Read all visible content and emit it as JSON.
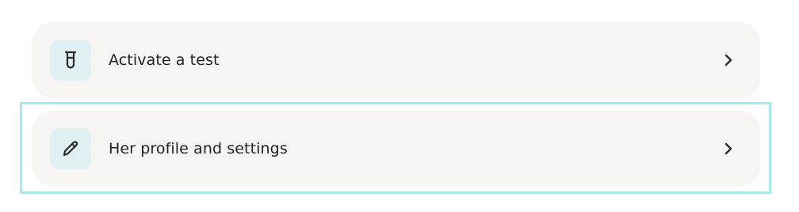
{
  "menu": {
    "items": [
      {
        "label": "Activate a test",
        "icon": "test-tube-icon",
        "trailing_icon": "chevron-right-icon"
      },
      {
        "label": "Her profile and settings",
        "icon": "pencil-icon",
        "trailing_icon": "chevron-right-icon",
        "focused": true
      }
    ]
  },
  "colors": {
    "card_background": "#f6f5f2",
    "icon_background": "#e0f0f2",
    "focus_ring": "#a8e8f0",
    "text": "#222222"
  }
}
